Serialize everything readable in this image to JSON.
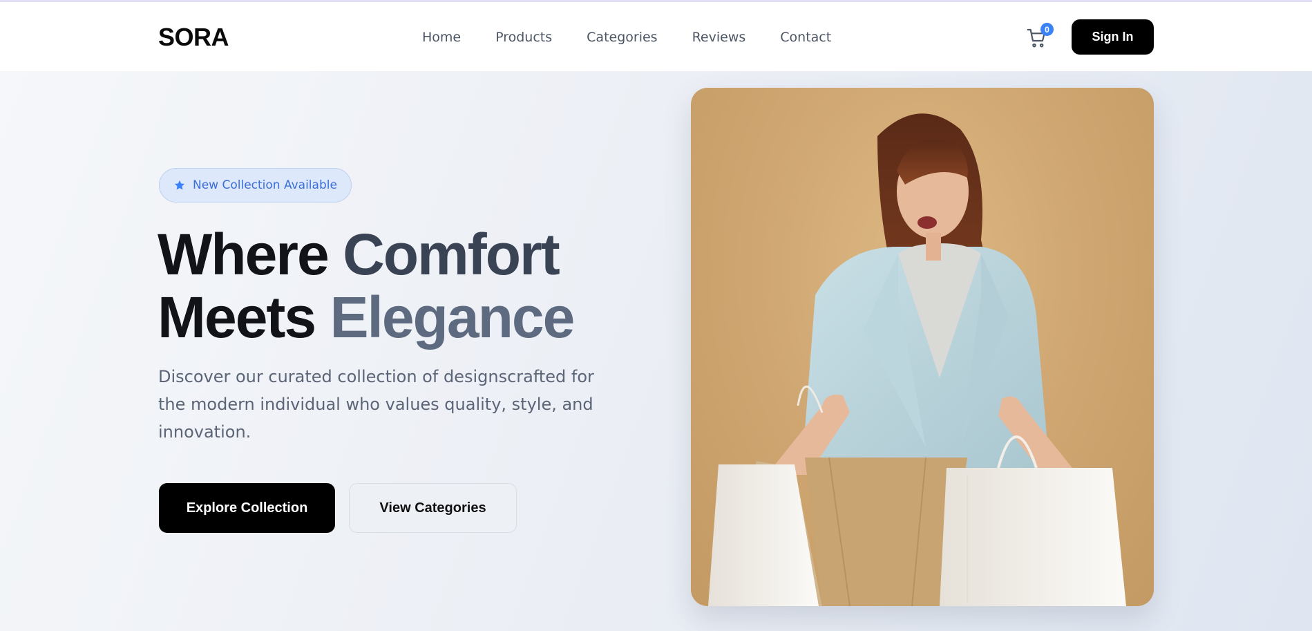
{
  "brand": {
    "logo": "SORA"
  },
  "nav": {
    "items": [
      {
        "label": "Home"
      },
      {
        "label": "Products"
      },
      {
        "label": "Categories"
      },
      {
        "label": "Reviews"
      },
      {
        "label": "Contact"
      }
    ]
  },
  "header": {
    "cart_count": "0",
    "cart_icon": "cart-icon",
    "signin_label": "Sign In"
  },
  "hero": {
    "badge": {
      "icon": "star-icon",
      "label": "New Collection Available"
    },
    "headline": {
      "line1_a": "Where",
      "line1_b": "Comfort",
      "line2_a": "Meets",
      "line2_b": "Elegance"
    },
    "description": "Discover our curated collection of designscrafted for the modern individual who values quality, style, and innovation.",
    "primary_cta": "Explore Collection",
    "secondary_cta": "View Categories",
    "image": "woman-with-shopping-bags-photo"
  },
  "colors": {
    "accent": "#3b82f6",
    "primary_button": "#000000",
    "background_start": "#f5f7fa",
    "background_end": "#dfe6f1"
  }
}
